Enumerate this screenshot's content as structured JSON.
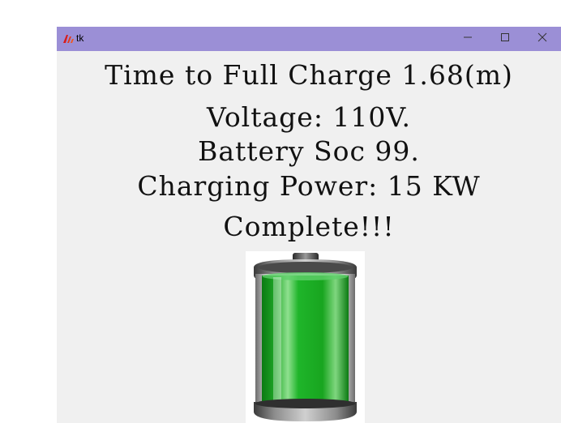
{
  "window": {
    "title": "tk",
    "icon": "tk-feather-icon",
    "controls": {
      "minimize": "minimize-icon",
      "maximize": "maximize-icon",
      "close": "close-icon"
    }
  },
  "labels": {
    "time_to_full": "Time to Full Charge 1.68(m)",
    "voltage": "Voltage: 110V.",
    "soc": "Battery Soc  99.",
    "power": "Charging Power: 15 KW",
    "status": "Complete!!!"
  },
  "battery": {
    "icon": "battery-full-icon",
    "level": 0.99,
    "fill_color": "#22b02a"
  },
  "colors": {
    "titlebar": "#9b8fd6",
    "window_bg": "#f0f0f0"
  }
}
